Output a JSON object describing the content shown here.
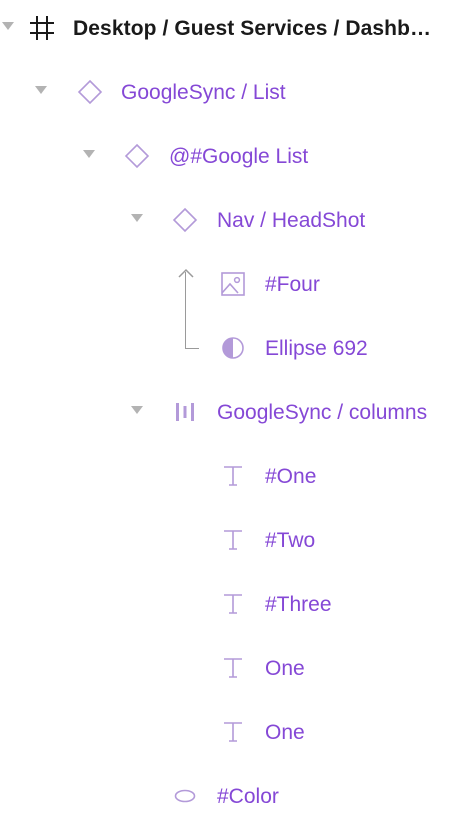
{
  "layers": [
    {
      "id": "frame",
      "label": "Desktop / Guest Services / Dashb…",
      "icon": "frame-hash-icon",
      "expanded": true
    },
    {
      "id": "googlesync-list",
      "label": "GoogleSync / List",
      "icon": "component-instance-icon",
      "expanded": true
    },
    {
      "id": "google-list",
      "label": "@#Google List",
      "icon": "component-instance-icon",
      "expanded": true
    },
    {
      "id": "nav-headshot",
      "label": "Nav / HeadShot",
      "icon": "component-instance-icon",
      "expanded": true
    },
    {
      "id": "four",
      "label": "#Four",
      "icon": "image-icon"
    },
    {
      "id": "ellipse-692",
      "label": "Ellipse 692",
      "icon": "ellipse-mask-icon"
    },
    {
      "id": "googlesync-columns",
      "label": "GoogleSync / columns",
      "icon": "auto-layout-columns-icon",
      "expanded": true
    },
    {
      "id": "one-hash",
      "label": "#One",
      "icon": "text-icon"
    },
    {
      "id": "two-hash",
      "label": "#Two",
      "icon": "text-icon"
    },
    {
      "id": "three-hash",
      "label": "#Three",
      "icon": "text-icon"
    },
    {
      "id": "one-a",
      "label": "One",
      "icon": "text-icon"
    },
    {
      "id": "one-b",
      "label": "One",
      "icon": "text-icon"
    },
    {
      "id": "color",
      "label": "#Color",
      "icon": "ellipse-icon"
    }
  ],
  "colors": {
    "component": "#8548d6",
    "component_icon": "#b39ad9",
    "frame_text": "#1a1a1a",
    "caret": "#b3b3b3",
    "connector": "#9a9a9a"
  }
}
